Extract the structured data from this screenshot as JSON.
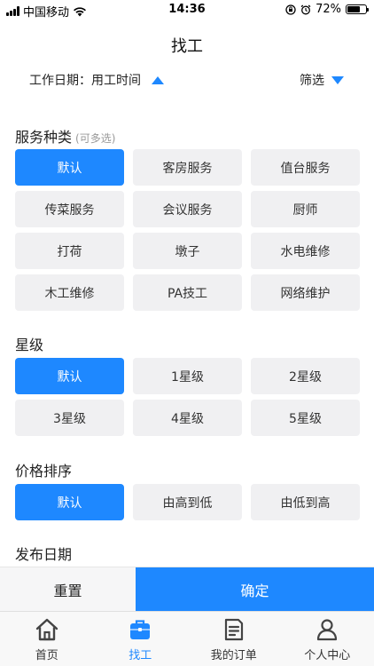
{
  "status_bar": {
    "carrier": "中国移动",
    "time": "14:36",
    "battery": "72%",
    "battery_level": 0.72
  },
  "nav": {
    "title": "找工"
  },
  "filter": {
    "work_date_label": "工作日期：用工时间",
    "screen_label": "筛选"
  },
  "sections": {
    "service_type": {
      "title": "服务种类",
      "hint": "(可多选)",
      "options": [
        "默认",
        "客房服务",
        "值台服务",
        "传菜服务",
        "会议服务",
        "厨师",
        "打荷",
        "墩子",
        "水电维修",
        "木工维修",
        "PA技工",
        "网络维护"
      ],
      "selected": "默认"
    },
    "star_level": {
      "title": "星级",
      "options": [
        "默认",
        "1星级",
        "2星级",
        "3星级",
        "4星级",
        "5星级"
      ],
      "selected": "默认"
    },
    "price_sort": {
      "title": "价格排序",
      "options": [
        "默认",
        "由高到低",
        "由低到高"
      ],
      "selected": "默认"
    },
    "publish_date": {
      "title": "发布日期"
    }
  },
  "actions": {
    "reset": "重置",
    "confirm": "确定"
  },
  "tabs": [
    {
      "label": "首页",
      "icon": "home-icon",
      "active": false
    },
    {
      "label": "找工",
      "icon": "briefcase-icon",
      "active": true
    },
    {
      "label": "我的订单",
      "icon": "document-icon",
      "active": false
    },
    {
      "label": "个人中心",
      "icon": "person-icon",
      "active": false
    }
  ],
  "colors": {
    "accent": "#1e88ff",
    "option_bg": "#f0f0f2",
    "tab_active": "#1e88ff"
  }
}
